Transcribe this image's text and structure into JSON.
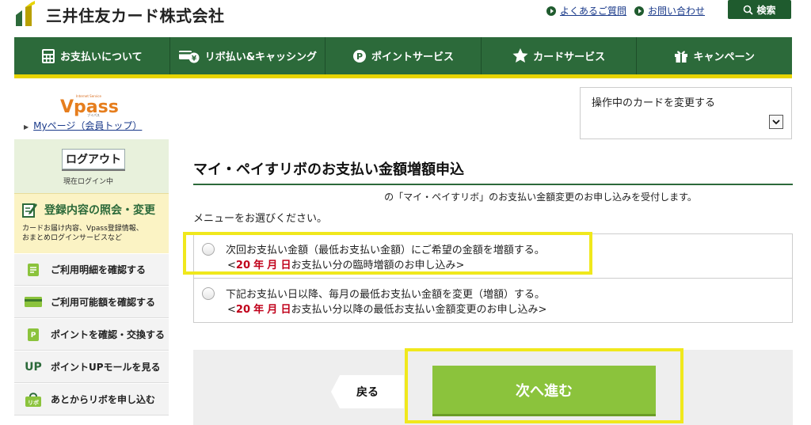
{
  "header": {
    "company": "三井住友カード株式会社",
    "faq_link": "よくあるご質問",
    "contact_link": "お問い合わせ",
    "search_label": "検索"
  },
  "nav": {
    "items": [
      {
        "label": "お支払いについて",
        "icon": "calculator-icon"
      },
      {
        "label": "リボ払い&キャッシング",
        "icon": "card-yen-icon"
      },
      {
        "label": "ポイントサービス",
        "icon": "point-p-icon"
      },
      {
        "label": "カードサービス",
        "icon": "star-icon"
      },
      {
        "label": "キャンペーン",
        "icon": "gift-icon"
      }
    ]
  },
  "sidebar": {
    "logo": "Vpass",
    "logo_sub": "Internet Service",
    "logo_kana": "ブイパス",
    "mypage_link": "Myページ（会員トップ）",
    "logout_label": "ログアウト",
    "logged_in_text": "現在ログイン中",
    "registration": {
      "title": "登録内容の照会・変更",
      "desc_line1": "カードお届け内容、Vpass登録情報、",
      "desc_line2": "おまとめログインサービスなど"
    },
    "items": [
      {
        "label": "ご利用明細を確認する",
        "icon": "statement-icon"
      },
      {
        "label": "ご利用可能額を確認する",
        "icon": "card-icon"
      },
      {
        "label": "ポイントを確認・交換する",
        "icon": "point-icon"
      },
      {
        "label": "ポイントUPモールを見る",
        "icon": "up-icon",
        "icon_text": "UP"
      },
      {
        "label": "あとからリボを申し込む",
        "icon": "revo-bag-icon",
        "icon_text": "リボ"
      }
    ]
  },
  "card_select": {
    "label": "操作中のカードを変更する"
  },
  "main": {
    "title": "マイ・ペイすリボのお支払い金額増額申込",
    "accepted_text": "の「マイ・ペイすリボ」のお支払い金額変更のお申し込みを受付します。",
    "choose_text": "メニューをお選びください。",
    "options": [
      {
        "line1": "次回お支払い金額（最低お支払い金額）にご希望の金額を増額する。",
        "prefix": "<",
        "year": "20",
        "year_unit": "年",
        "month_unit": "月",
        "day_unit": "日",
        "suffix": "お支払い分の臨時増額のお申し込み>"
      },
      {
        "line1": "下記お支払い日以降、毎月の最低お支払い金額を変更（増額）する。",
        "prefix": "<",
        "year": "20",
        "year_unit": "年",
        "month_unit": "月",
        "day_unit": "日",
        "suffix": "お支払い分以降の最低お支払い金額変更のお申し込み>"
      }
    ],
    "back_label": "戻る",
    "next_label": "次へ進む"
  },
  "colors": {
    "brand_green": "#2c6a3a",
    "accent_yellow": "#e7d400",
    "next_green": "#8bc33c",
    "highlight": "#f0e81c",
    "date_red": "#c0001a"
  }
}
